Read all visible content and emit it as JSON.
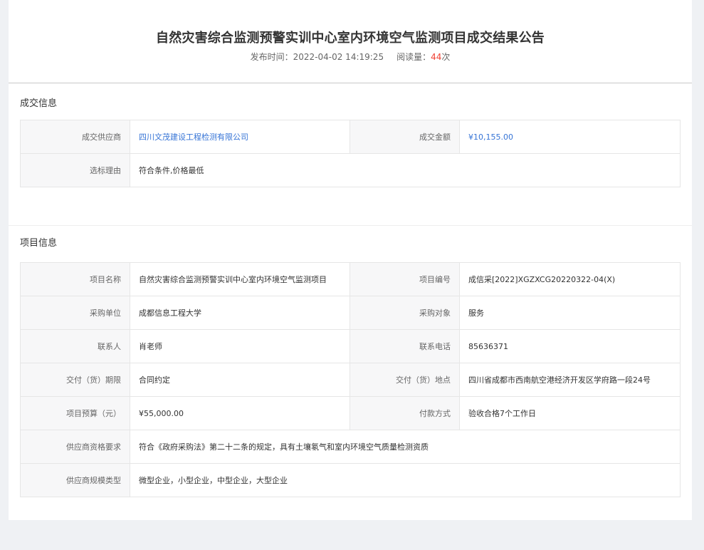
{
  "header": {
    "title": "自然灾害综合监测预警实训中心室内环境空气监测项目成交结果公告",
    "publish_label": "发布时间：",
    "publish_time": "2022-04-02 14:19:25",
    "views_label": "阅读量：",
    "views_count": "44",
    "views_unit": "次"
  },
  "deal_info": {
    "section_title": "成交信息",
    "supplier_label": "成交供应商",
    "supplier_value": "四川文茂建设工程检测有限公司",
    "amount_label": "成交金额",
    "amount_value": "¥10,155.00",
    "reason_label": "选标理由",
    "reason_value": "符合条件,价格最低"
  },
  "project_info": {
    "section_title": "项目信息",
    "rows": [
      {
        "l1": "项目名称",
        "v1": "自然灾害综合监测预警实训中心室内环境空气监测项目",
        "l2": "项目编号",
        "v2": "成信采[2022]XGZXCG20220322-04(X)"
      },
      {
        "l1": "采购单位",
        "v1": "成都信息工程大学",
        "l2": "采购对象",
        "v2": "服务"
      },
      {
        "l1": "联系人",
        "v1": "肖老师",
        "l2": "联系电话",
        "v2": "85636371"
      },
      {
        "l1": "交付（货）期限",
        "v1": "合同约定",
        "l2": "交付（货）地点",
        "v2": "四川省成都市西南航空港经济开发区学府路一段24号"
      },
      {
        "l1": "项目预算（元）",
        "v1": "¥55,000.00",
        "l2": "付款方式",
        "v2": "验收合格7个工作日"
      }
    ],
    "qualification_label": "供应商资格要求",
    "qualification_value": "符合《政府采购法》第二十二条的规定，具有土壤氡气和室内环境空气质量检测资质",
    "scale_label": "供应商规模类型",
    "scale_value": "微型企业，小型企业，中型企业，大型企业"
  }
}
